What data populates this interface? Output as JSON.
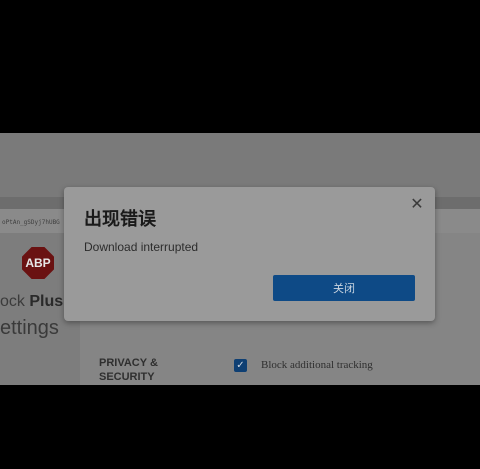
{
  "page": {
    "url_text": "oPtAn_gSDyj7hUBG",
    "logo_text": "ABP",
    "brand_prefix": "ock ",
    "brand_bold": "Plus",
    "settings_title": "ettings",
    "section_label": "PRIVACY & SECURITY",
    "checkbox_label": "Block additional tracking",
    "checkbox_checked": true
  },
  "dialog": {
    "title": "出现错误",
    "message": "Download interrupted",
    "close_icon": "close-icon",
    "button_label": "关闭"
  },
  "colors": {
    "button": "#0e4a86",
    "logo": "#6a1212"
  }
}
